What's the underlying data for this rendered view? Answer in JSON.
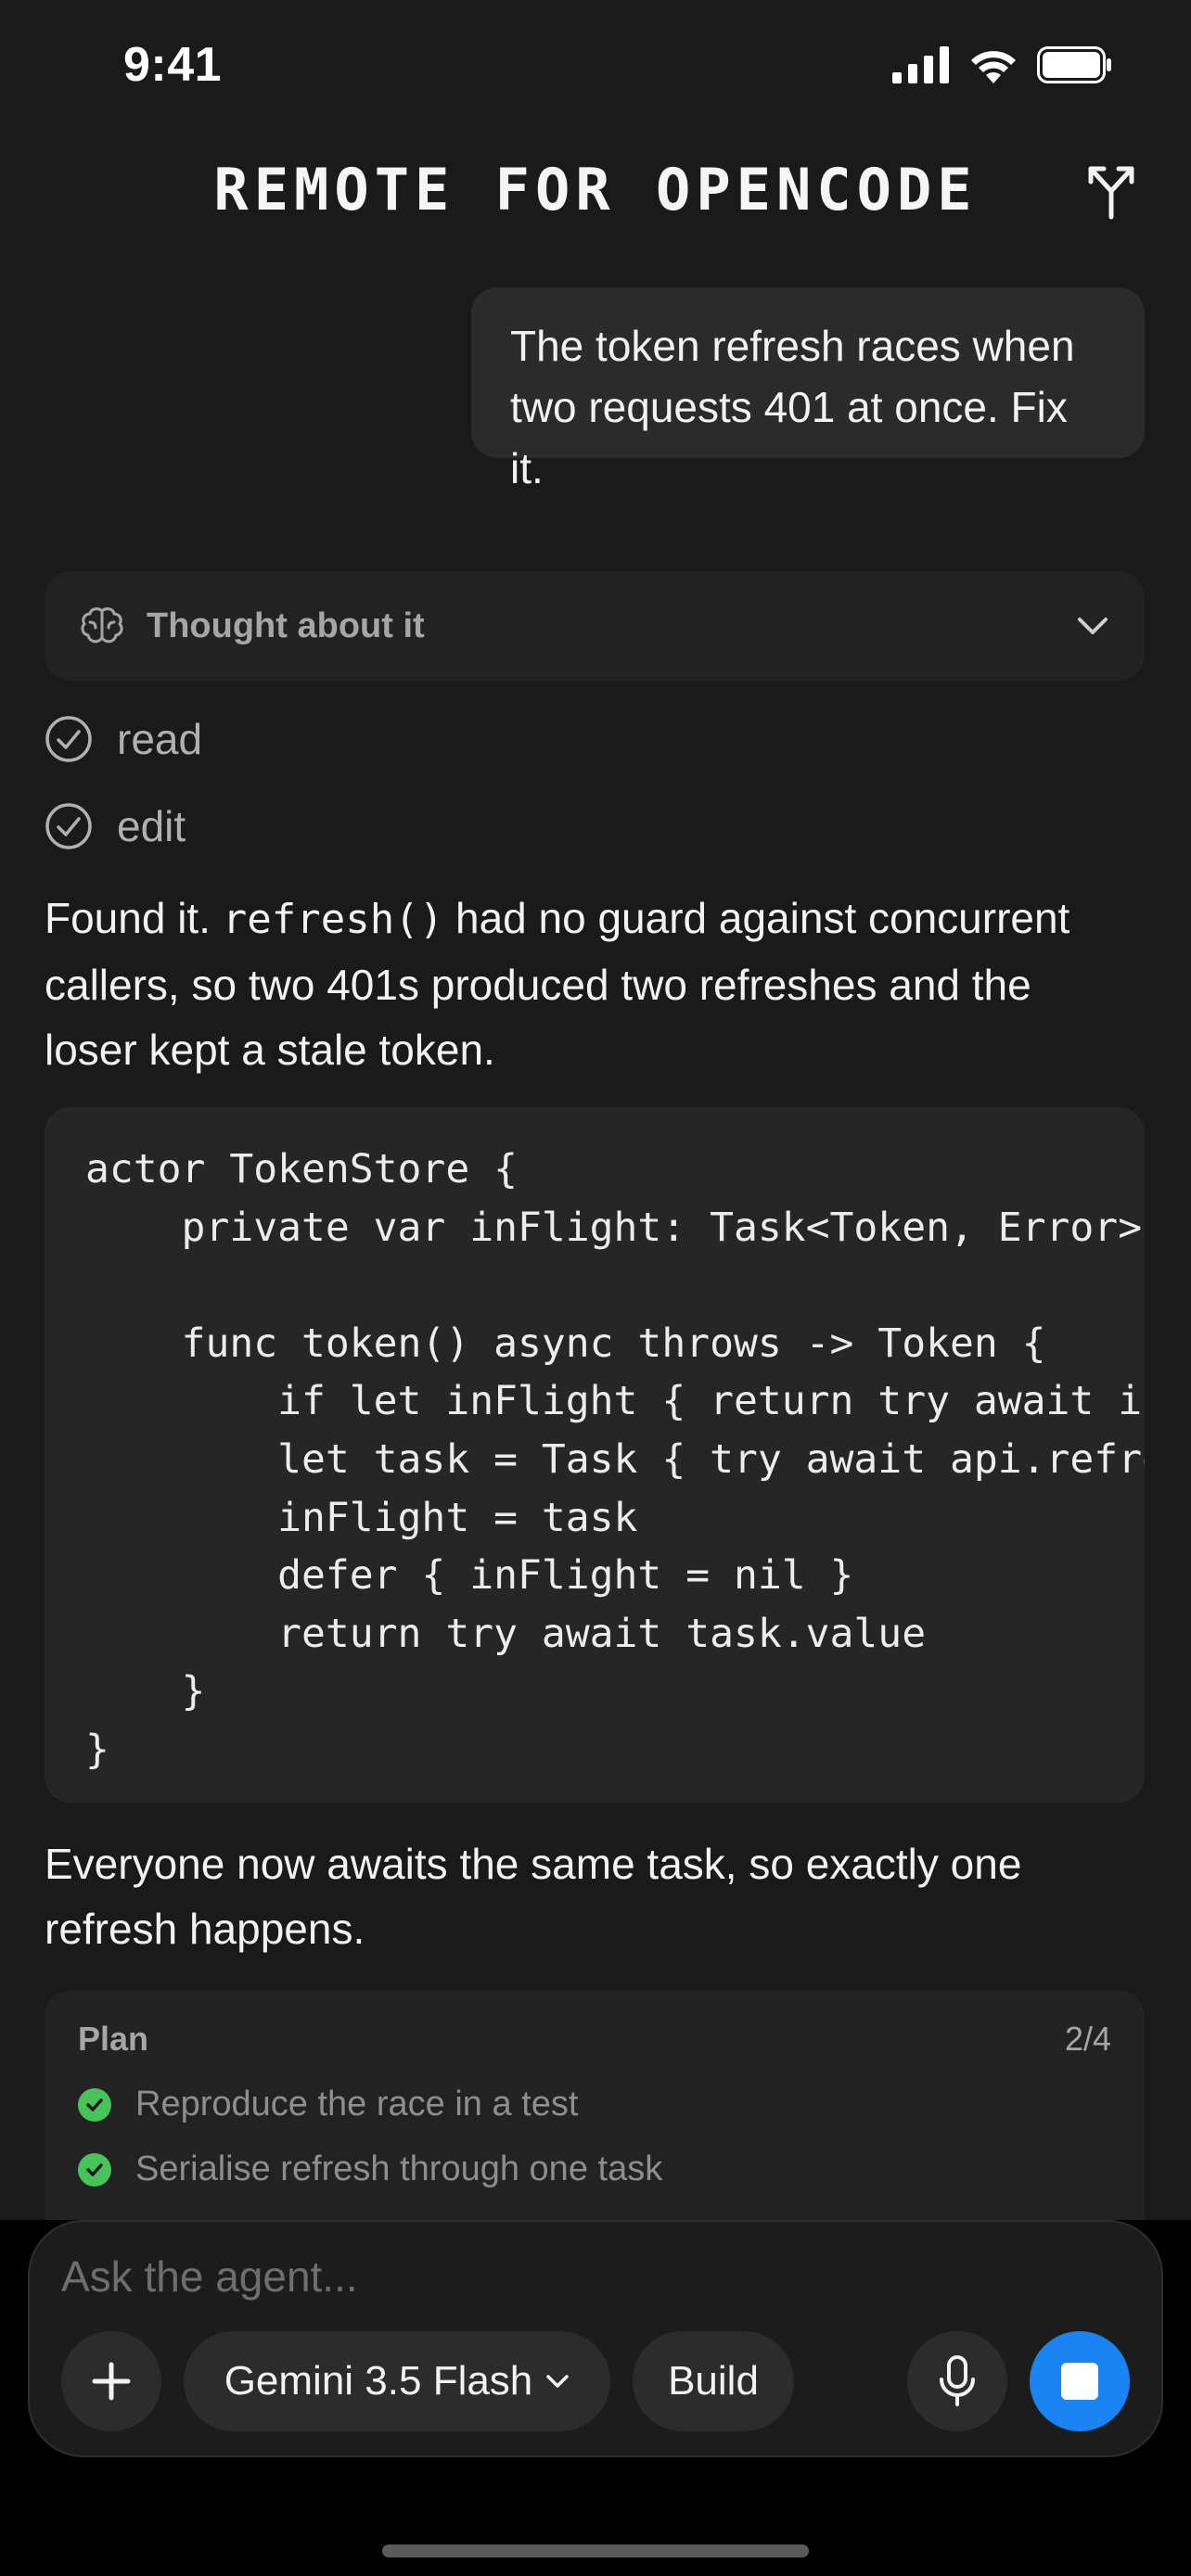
{
  "status_bar": {
    "time": "9:41"
  },
  "header": {
    "title": "REMOTE FOR OPENCODE"
  },
  "user_message": "The token refresh races when two requests 401 at once. Fix it.",
  "thought": {
    "label": "Thought about it"
  },
  "tools": [
    {
      "label": "read",
      "state": "done"
    },
    {
      "label": "edit",
      "state": "done"
    }
  ],
  "assistant": {
    "para1_before": "Found it. ",
    "para1_code": "refresh()",
    "para1_after": " had no guard against concurrent callers, so two 401s produced two refreshes and the loser kept a stale token.",
    "code": "actor TokenStore {\n    private var inFlight: Task<Token, Error>?\n\n    func token() async throws -> Token {\n        if let inFlight { return try await inFlight.value }\n        let task = Task { try await api.refresh() }\n        inFlight = task\n        defer { inFlight = nil }\n        return try await task.value\n    }\n}",
    "para2": "Everyone now awaits the same task, so exactly one refresh happens."
  },
  "plan": {
    "title": "Plan",
    "count": "2/4",
    "items": [
      {
        "label": "Reproduce the race in a test",
        "done": true
      },
      {
        "label": "Serialise refresh through one task",
        "done": true
      }
    ]
  },
  "composer": {
    "placeholder": "Ask the agent...",
    "model": "Gemini 3.5 Flash",
    "mode": "Build"
  },
  "colors": {
    "background": "#1a1a1a",
    "accent": "#1a84f5",
    "check": "#46c45a"
  }
}
